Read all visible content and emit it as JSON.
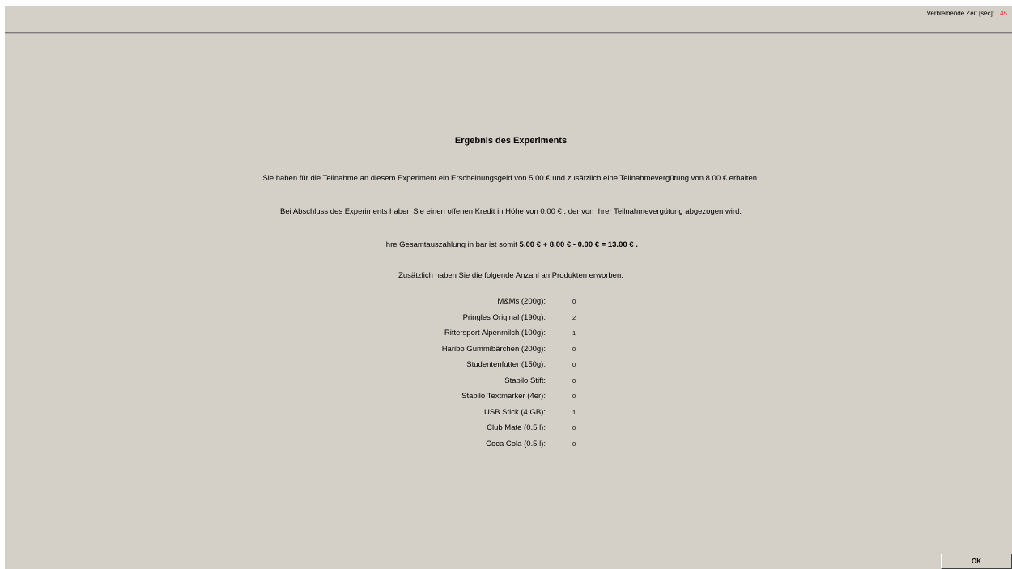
{
  "header": {
    "timer_label": "Verbleibende Zeit [sec]:",
    "timer_value": "45"
  },
  "result": {
    "title": "Ergebnis des Experiments",
    "line1": "Sie haben für die Teilnahme an diesem Experiment ein Erscheinungsgeld von 5.00 €  und zusätzlich eine Teilnahmevergütung von 8.00 €  erhalten.",
    "line2": "Bei Abschluss des Experiments haben Sie einen offenen Kredit in Höhe von 0.00 € , der von Ihrer Teilnahmevergütung abgezogen wird.",
    "line3_prefix": "Ihre Gesamtauszahlung in bar ist somit ",
    "line3_bold": "5.00 €  + 8.00 €  - 0.00 €  = 13.00 € .",
    "line4": "Zusätzlich haben Sie die folgende Anzahl an Produkten erworben:"
  },
  "products": [
    {
      "label": "M&Ms (200g):",
      "count": "0"
    },
    {
      "label": "Pringles Original (190g):",
      "count": "2"
    },
    {
      "label": "Rittersport Alpenmilch (100g):",
      "count": "1"
    },
    {
      "label": "Haribo Gummibärchen (200g):",
      "count": "0"
    },
    {
      "label": "Studentenfutter (150g):",
      "count": "0"
    },
    {
      "label": "Stabilo Stift:",
      "count": "0"
    },
    {
      "label": "Stabilo Textmarker (4er):",
      "count": "0"
    },
    {
      "label": "USB Stick (4 GB):",
      "count": "1"
    },
    {
      "label": "Club Mate (0.5 l):",
      "count": "0"
    },
    {
      "label": "Coca Cola (0.5 l):",
      "count": "0"
    }
  ],
  "footer": {
    "ok_label": "OK"
  },
  "colors": {
    "background": "#d4d0c8",
    "timer_value": "#e8241c"
  }
}
